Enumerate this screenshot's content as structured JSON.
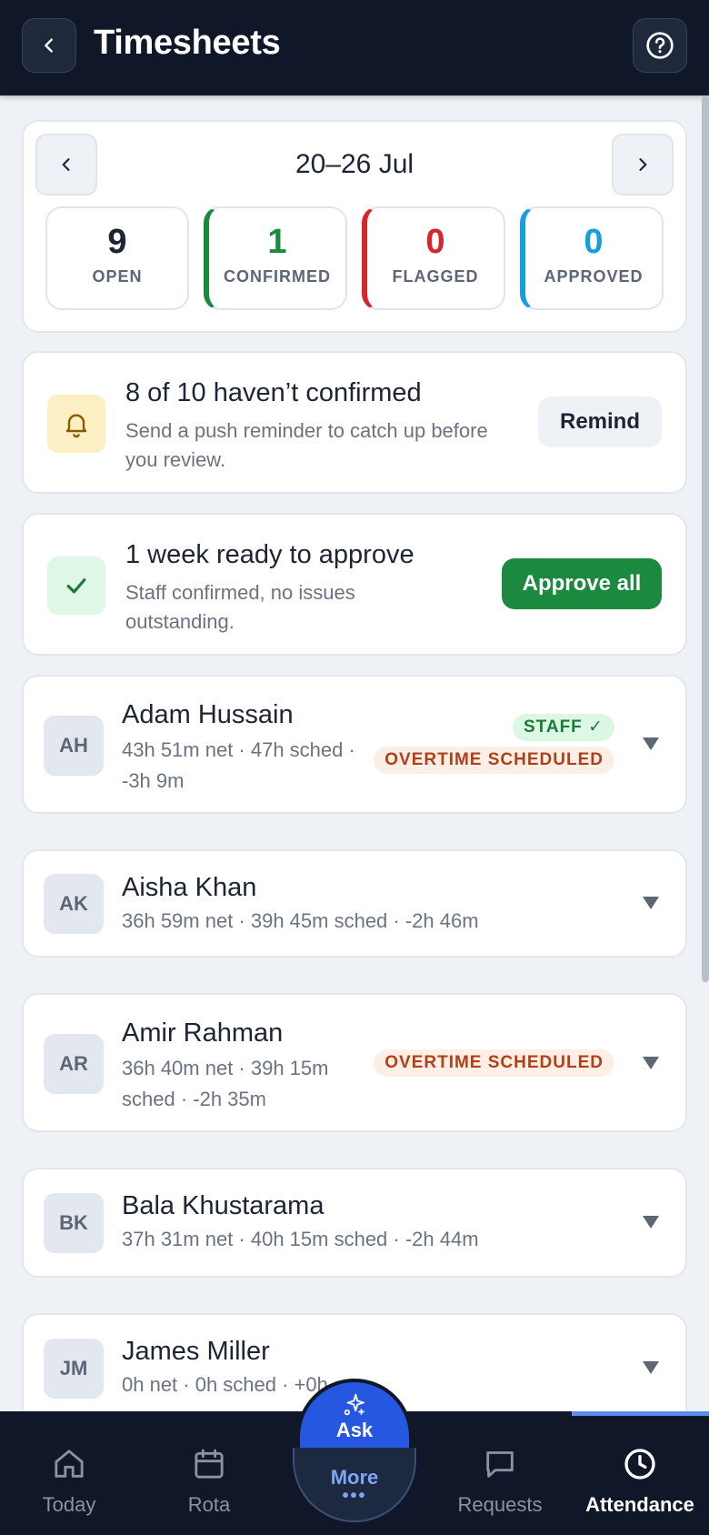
{
  "header": {
    "title": "Timesheets"
  },
  "week": {
    "range": "20–26 Jul",
    "stats": {
      "open": {
        "value": "9",
        "label": "OPEN"
      },
      "confirmed": {
        "value": "1",
        "label": "CONFIRMED"
      },
      "flagged": {
        "value": "0",
        "label": "FLAGGED"
      },
      "approved": {
        "value": "0",
        "label": "APPROVED"
      }
    }
  },
  "remind": {
    "title": "8 of 10 haven’t confirmed",
    "description": "Send a push reminder to catch up before you review.",
    "button": "Remind"
  },
  "approve": {
    "title": "1 week ready to approve",
    "description": "Staff confirmed, no issues outstanding.",
    "button": "Approve all"
  },
  "staff": [
    {
      "initials": "AH",
      "name": "Adam Hussain",
      "meta": "43h 51m net · 47h sched · -3h 9m",
      "badges": [
        "STAFF ✓",
        "OVERTIME SCHEDULED"
      ]
    },
    {
      "initials": "AK",
      "name": "Aisha Khan",
      "meta": "36h 59m net · 39h 45m sched · -2h 46m",
      "badges": []
    },
    {
      "initials": "AR",
      "name": "Amir Rahman",
      "meta": "36h 40m net · 39h 15m sched · -2h 35m",
      "badges": [
        "OVERTIME SCHEDULED"
      ]
    },
    {
      "initials": "BK",
      "name": "Bala Khustarama",
      "meta": "37h 31m net · 40h 15m sched · -2h 44m",
      "badges": []
    },
    {
      "initials": "JM",
      "name": "James Miller",
      "meta": "0h net · 0h sched · +0h",
      "badges": []
    }
  ],
  "nav": {
    "today": "Today",
    "rota": "Rota",
    "ask": "Ask",
    "more": "More",
    "more_dots": "•••",
    "requests": "Requests",
    "attendance": "Attendance",
    "active": "attendance"
  },
  "colors": {
    "header_bg": "#0f1729",
    "confirmed": "#1a8a3e",
    "flagged": "#d8242b",
    "approved": "#159ee0",
    "ask_blue": "#2557e0"
  }
}
